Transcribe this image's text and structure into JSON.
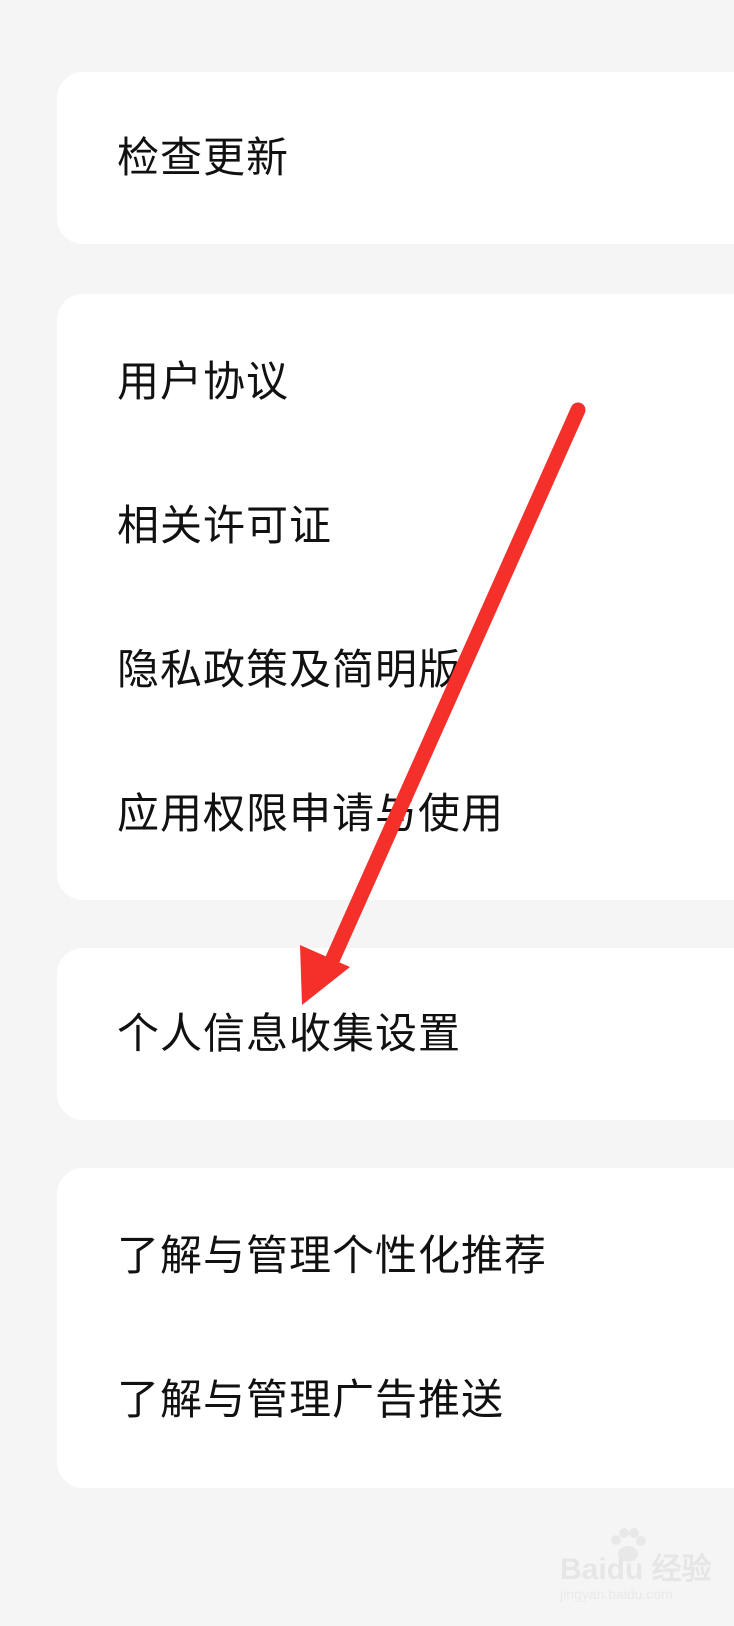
{
  "groups": [
    {
      "items": [
        {
          "label": "检查更新"
        }
      ]
    },
    {
      "items": [
        {
          "label": "用户协议"
        },
        {
          "label": "相关许可证"
        },
        {
          "label": "隐私政策及简明版"
        },
        {
          "label": "应用权限申请与使用"
        }
      ]
    },
    {
      "items": [
        {
          "label": "个人信息收集设置"
        }
      ]
    },
    {
      "items": [
        {
          "label": "了解与管理个性化推荐"
        },
        {
          "label": "了解与管理广告推送"
        }
      ]
    }
  ],
  "annotation": {
    "color": "#f5302a"
  },
  "watermark": {
    "logo_text": "Baidu 经验",
    "sub_text": "jingyan.baidu.com"
  }
}
